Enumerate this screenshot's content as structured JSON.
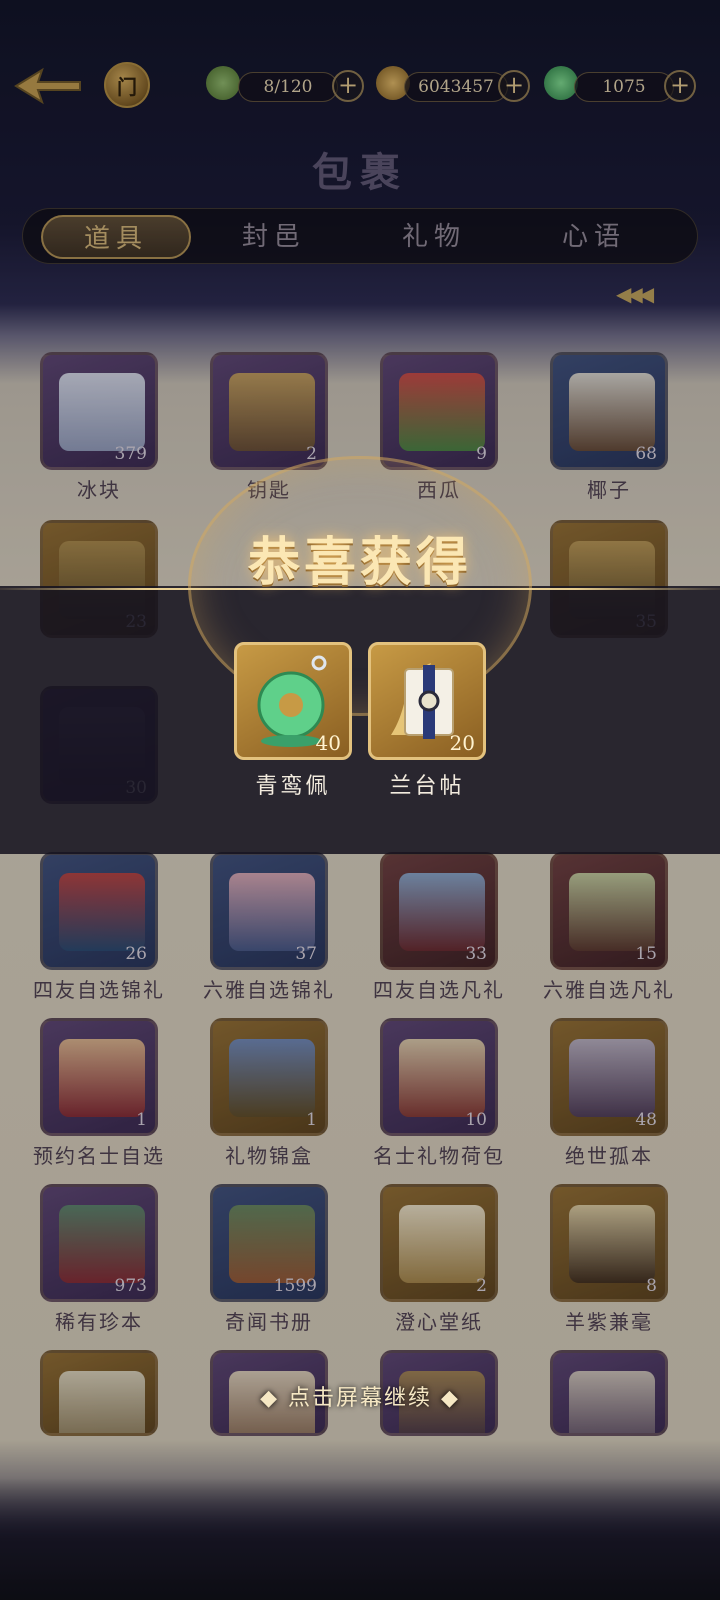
{
  "header": {
    "title": "包裹",
    "resources": [
      {
        "name": "leaf-stamina",
        "value": "8/120",
        "icon": "leaf-icon"
      },
      {
        "name": "copper-coin",
        "value": "6043457",
        "icon": "coin-icon"
      },
      {
        "name": "jade",
        "value": "1075",
        "icon": "jade-icon"
      }
    ],
    "plus": "+",
    "home_glyph": "门"
  },
  "tabs": [
    {
      "label": "道具",
      "active": true
    },
    {
      "label": "封邑",
      "active": false
    },
    {
      "label": "礼物",
      "active": false
    },
    {
      "label": "心语",
      "active": false
    }
  ],
  "items": [
    {
      "name": "冰块",
      "count": "379",
      "style": "purple"
    },
    {
      "name": "钥匙",
      "count": "2",
      "style": "purple"
    },
    {
      "name": "西瓜",
      "count": "9",
      "style": "purple"
    },
    {
      "name": "椰子",
      "count": "68",
      "style": "blue"
    },
    {
      "name": "四友自选锦礼",
      "count": "26",
      "style": "blue"
    },
    {
      "name": "六雅自选锦礼",
      "count": "37",
      "style": "blue"
    },
    {
      "name": "四友自选凡礼",
      "count": "33",
      "style": "red"
    },
    {
      "name": "六雅自选凡礼",
      "count": "15",
      "style": "red"
    },
    {
      "name": "预约名士自选",
      "count": "1",
      "style": "purple"
    },
    {
      "name": "礼物锦盒",
      "count": "1",
      "style": "gold"
    },
    {
      "name": "名士礼物荷包",
      "count": "10",
      "style": "purple"
    },
    {
      "name": "绝世孤本",
      "count": "48",
      "style": "gold"
    },
    {
      "name": "稀有珍本",
      "count": "973",
      "style": "purple"
    },
    {
      "name": "奇闻书册",
      "count": "1599",
      "style": "blue"
    },
    {
      "name": "澄心堂纸",
      "count": "2",
      "style": "gold"
    },
    {
      "name": "羊紫兼毫",
      "count": "8",
      "style": "gold"
    }
  ],
  "hidden_row_counts": [
    "23",
    "35"
  ],
  "hidden_row3_count": "30",
  "overlay": {
    "title": "恭喜获得",
    "rewards": [
      {
        "name": "青鸾佩",
        "count": "40",
        "icon": "jade-pendant-icon"
      },
      {
        "name": "兰台帖",
        "count": "20",
        "icon": "scroll-letter-icon"
      }
    ],
    "continue_text": "◆ 点击屏幕继续 ◆"
  },
  "colors": {
    "gold": "#e3c27e",
    "banner": "#14121e"
  }
}
